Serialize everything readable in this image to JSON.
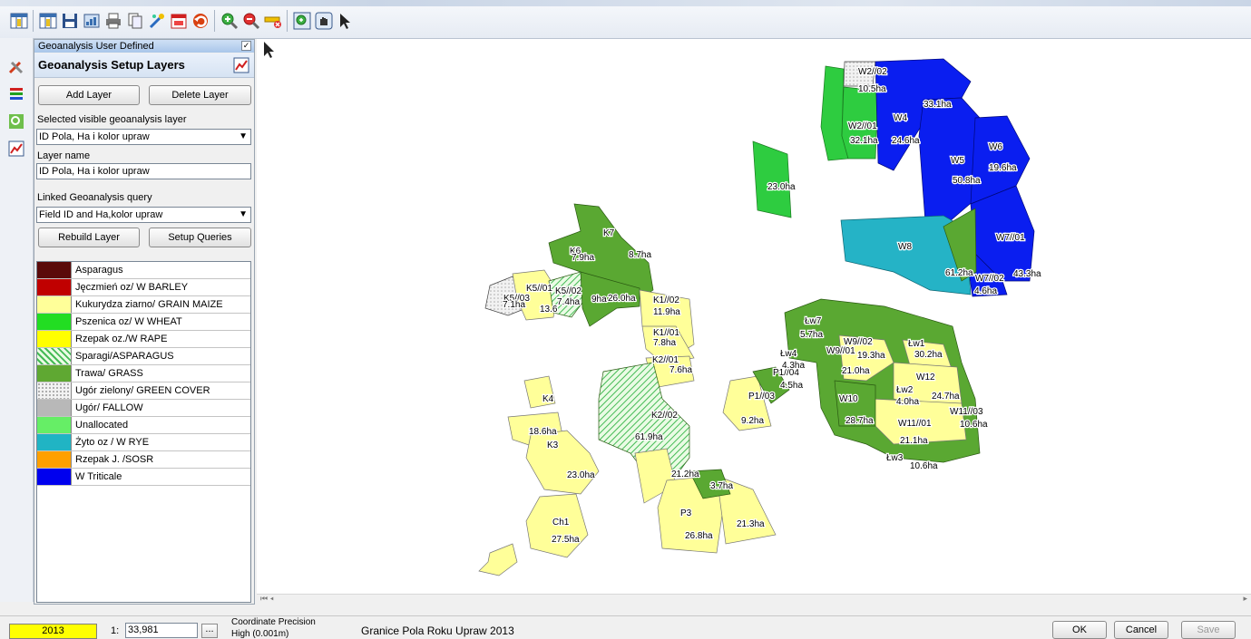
{
  "panel": {
    "title": "Geoanalysis User Defined",
    "heading": "Geoanalysis Setup Layers",
    "add_layer": "Add Layer",
    "delete_layer": "Delete Layer",
    "selected_layer_label": "Selected visible geoanalysis layer",
    "selected_layer_value": "ID Pola, Ha i kolor upraw",
    "layer_name_label": "Layer name",
    "layer_name_value": "ID Pola, Ha i kolor upraw",
    "linked_query_label": "Linked Geoanalysis query",
    "linked_query_value": "Field ID and Ha,kolor upraw",
    "rebuild_layer": "Rebuild Layer",
    "setup_queries": "Setup Queries"
  },
  "legend": [
    {
      "label": "Asparagus",
      "color": "#5a0a0a"
    },
    {
      "label": "Jęczmień oz/ W BARLEY",
      "color": "#c00000"
    },
    {
      "label": "Kukurydza ziarno/ GRAIN MAIZE",
      "color": "#ffff99"
    },
    {
      "label": "Pszenica oz/ W WHEAT",
      "color": "#22dd22"
    },
    {
      "label": "Rzepak oz./W RAPE",
      "color": "#ffff00"
    },
    {
      "label": "Sparagi/ASPARAGUS",
      "color": "#66dd99"
    },
    {
      "label": "Trawa/ GRASS",
      "color": "#5fa832"
    },
    {
      "label": "Ugór zielony/ GREEN COVER",
      "color": "#d8d8d8"
    },
    {
      "label": "Ugór/ FALLOW",
      "color": "#b8b8b8"
    },
    {
      "label": "Unallocated",
      "color": "#66ee66"
    },
    {
      "label": "Żyto oz / W RYE",
      "color": "#20b4c4"
    },
    {
      "label": "Rzepak J. /SOSR",
      "color": "#ffa000"
    },
    {
      "label": "W Triticale",
      "color": "#0000ee"
    }
  ],
  "map_labels": [
    {
      "text": "W2//02"
    },
    {
      "text": "10.5ha"
    },
    {
      "text": "33.1ha"
    },
    {
      "text": "W4"
    },
    {
      "text": "W2//01"
    },
    {
      "text": "32.1ha"
    },
    {
      "text": "24.6ha"
    },
    {
      "text": "W6"
    },
    {
      "text": "W5"
    },
    {
      "text": "19.6ha"
    },
    {
      "text": "50.8ha"
    },
    {
      "text": "23.0ha"
    },
    {
      "text": "W8"
    },
    {
      "text": "W7//01"
    },
    {
      "text": "61.2ha"
    },
    {
      "text": "W7//02"
    },
    {
      "text": "43.3ha"
    },
    {
      "text": "4.6ha"
    },
    {
      "text": "K7"
    },
    {
      "text": "K6"
    },
    {
      "text": "8.7ha"
    },
    {
      "text": "7.9ha"
    },
    {
      "text": "K5//01"
    },
    {
      "text": "K5//02"
    },
    {
      "text": "K5//03"
    },
    {
      "text": "7.1ha"
    },
    {
      "text": "13.6"
    },
    {
      "text": "7.4ha"
    },
    {
      "text": "9ha"
    },
    {
      "text": "26.0ha"
    },
    {
      "text": "K1//02"
    },
    {
      "text": "11.9ha"
    },
    {
      "text": "K1//01"
    },
    {
      "text": "7.8ha"
    },
    {
      "text": "K2//01"
    },
    {
      "text": "7.6ha"
    },
    {
      "text": "K4"
    },
    {
      "text": "K2//02"
    },
    {
      "text": "18.6ha"
    },
    {
      "text": "K3"
    },
    {
      "text": "61.9ha"
    },
    {
      "text": "23.0ha"
    },
    {
      "text": "21.2ha"
    },
    {
      "text": "3.7ha"
    },
    {
      "text": "Ch1"
    },
    {
      "text": "P3"
    },
    {
      "text": "21.3ha"
    },
    {
      "text": "27.5ha"
    },
    {
      "text": "26.8ha"
    },
    {
      "text": "P1//03"
    },
    {
      "text": "9.2ha"
    },
    {
      "text": "P1//04"
    },
    {
      "text": "4.5ha"
    },
    {
      "text": "Łw4"
    },
    {
      "text": "4.3ha"
    },
    {
      "text": "Łw7"
    },
    {
      "text": "5.7ha"
    },
    {
      "text": "W9//02"
    },
    {
      "text": "W9//01"
    },
    {
      "text": "19.3ha"
    },
    {
      "text": "21.0ha"
    },
    {
      "text": "Łw1"
    },
    {
      "text": "30.2ha"
    },
    {
      "text": "W12"
    },
    {
      "text": "Łw2"
    },
    {
      "text": "24.7ha"
    },
    {
      "text": "4.0ha"
    },
    {
      "text": "W10"
    },
    {
      "text": "W11//03"
    },
    {
      "text": "28.7ha"
    },
    {
      "text": "W11//01"
    },
    {
      "text": "10.6ha"
    },
    {
      "text": "21.1ha"
    },
    {
      "text": "Łw3"
    },
    {
      "text": "10.6ha"
    }
  ],
  "status": {
    "year": "2013",
    "scale_prefix": "1:",
    "scale_value": "33,981",
    "coord_precision_label": "Coordinate Precision",
    "coord_precision_value": "High (0.001m)",
    "layer_title": "Granice Pola Roku Upraw 2013",
    "ok": "OK",
    "cancel": "Cancel",
    "save": "Save"
  }
}
